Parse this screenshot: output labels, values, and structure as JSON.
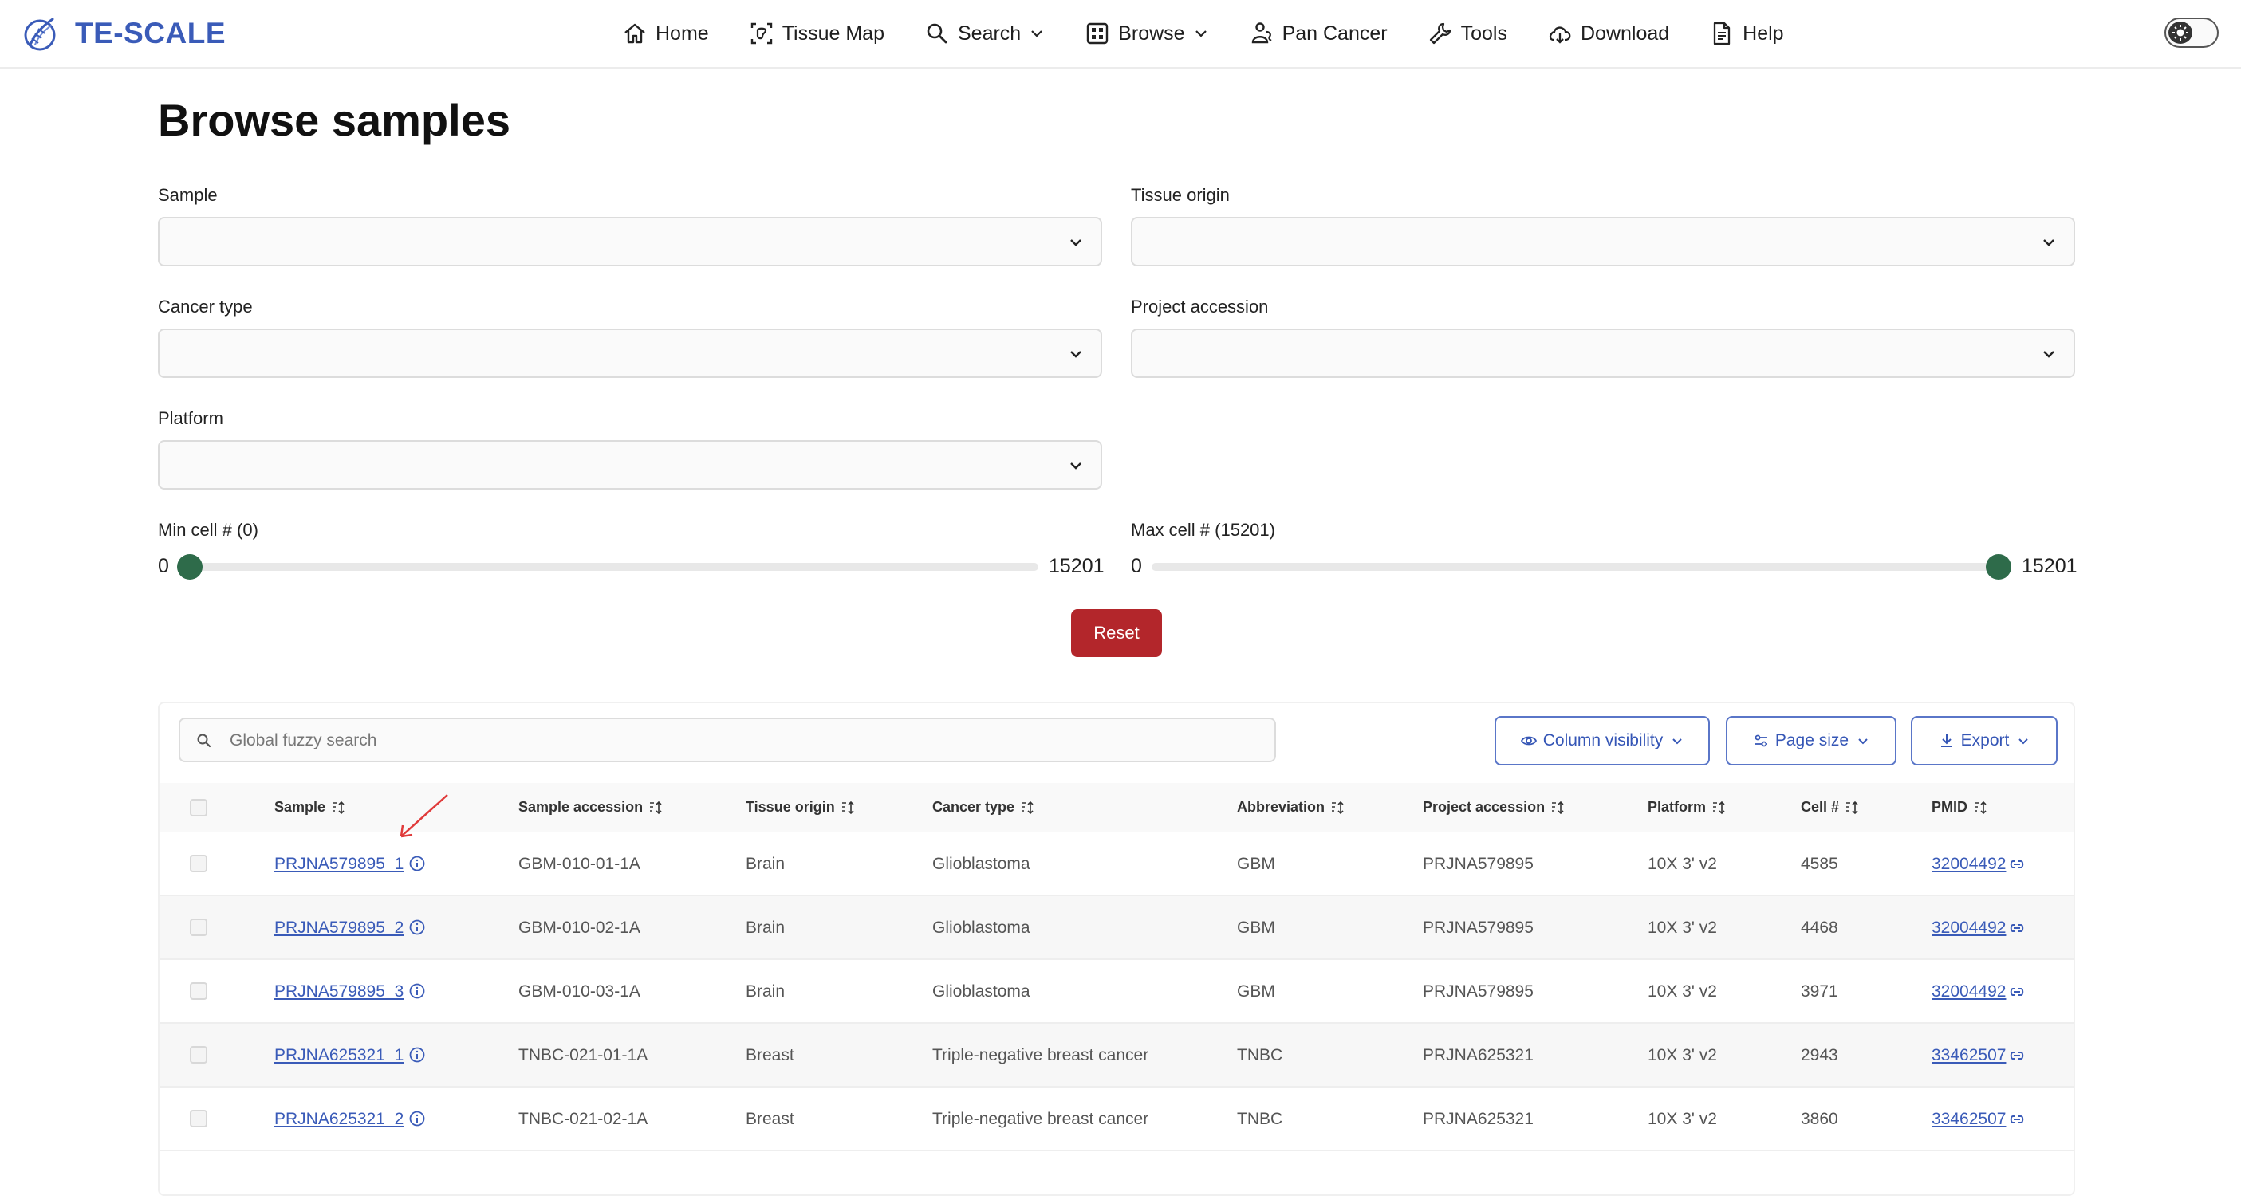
{
  "app": {
    "name": "TE-SCALE"
  },
  "colors": {
    "brand": "#3a5bb8",
    "reset": "#b3262b",
    "slider_thumb": "#2e6b4a",
    "annotation_arrow": "#e03a3a"
  },
  "nav": [
    {
      "label": "Home",
      "icon": "home-icon"
    },
    {
      "label": "Tissue Map",
      "icon": "tissue-map-icon"
    },
    {
      "label": "Search",
      "icon": "search-icon",
      "dropdown": true
    },
    {
      "label": "Browse",
      "icon": "grid-icon",
      "dropdown": true
    },
    {
      "label": "Pan Cancer",
      "icon": "pan-cancer-icon"
    },
    {
      "label": "Tools",
      "icon": "wrench-icon"
    },
    {
      "label": "Download",
      "icon": "cloud-download-icon"
    },
    {
      "label": "Help",
      "icon": "document-icon"
    }
  ],
  "page": {
    "title": "Browse samples"
  },
  "filters": {
    "sample": {
      "label": "Sample",
      "value": ""
    },
    "tissue_origin": {
      "label": "Tissue origin",
      "value": ""
    },
    "cancer_type": {
      "label": "Cancer type",
      "value": ""
    },
    "project_accession": {
      "label": "Project accession",
      "value": ""
    },
    "platform": {
      "label": "Platform",
      "value": ""
    }
  },
  "sliders": {
    "min": {
      "label": "Min cell # (0)",
      "range_min": "0",
      "range_max": "15201",
      "value": 0
    },
    "max": {
      "label": "Max cell # (15201)",
      "range_min": "0",
      "range_max": "15201",
      "value": 15201
    }
  },
  "reset_label": "Reset",
  "table": {
    "search_placeholder": "Global fuzzy search",
    "buttons": {
      "column_visibility": "Column visibility",
      "page_size": "Page size",
      "export": "Export"
    },
    "columns": [
      "Sample",
      "Sample accession",
      "Tissue origin",
      "Cancer type",
      "Abbreviation",
      "Project accession",
      "Platform",
      "Cell #",
      "PMID"
    ],
    "rows": [
      {
        "sample": "PRJNA579895_1",
        "sample_accession": "GBM-010-01-1A",
        "tissue_origin": "Brain",
        "cancer_type": "Glioblastoma",
        "abbreviation": "GBM",
        "project_accession": "PRJNA579895",
        "platform": "10X 3' v2",
        "cells": "4585",
        "pmid": "32004492"
      },
      {
        "sample": "PRJNA579895_2",
        "sample_accession": "GBM-010-02-1A",
        "tissue_origin": "Brain",
        "cancer_type": "Glioblastoma",
        "abbreviation": "GBM",
        "project_accession": "PRJNA579895",
        "platform": "10X 3' v2",
        "cells": "4468",
        "pmid": "32004492"
      },
      {
        "sample": "PRJNA579895_3",
        "sample_accession": "GBM-010-03-1A",
        "tissue_origin": "Brain",
        "cancer_type": "Glioblastoma",
        "abbreviation": "GBM",
        "project_accession": "PRJNA579895",
        "platform": "10X 3' v2",
        "cells": "3971",
        "pmid": "32004492"
      },
      {
        "sample": "PRJNA625321_1",
        "sample_accession": "TNBC-021-01-1A",
        "tissue_origin": "Breast",
        "cancer_type": "Triple-negative breast cancer",
        "abbreviation": "TNBC",
        "project_accession": "PRJNA625321",
        "platform": "10X 3' v2",
        "cells": "2943",
        "pmid": "33462507"
      },
      {
        "sample": "PRJNA625321_2",
        "sample_accession": "TNBC-021-02-1A",
        "tissue_origin": "Breast",
        "cancer_type": "Triple-negative breast cancer",
        "abbreviation": "TNBC",
        "project_accession": "PRJNA625321",
        "platform": "10X 3' v2",
        "cells": "3860",
        "pmid": "33462507"
      }
    ]
  }
}
